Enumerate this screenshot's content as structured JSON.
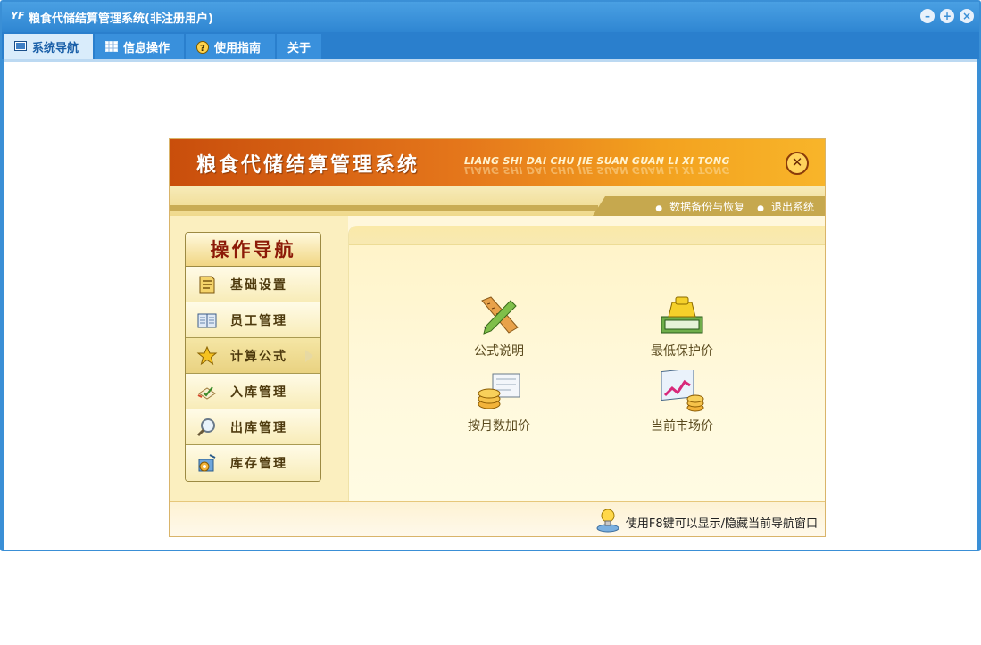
{
  "window": {
    "title": "粮食代储结算管理系统(非注册用户)",
    "app_icon": "yf-logo",
    "controls": [
      "minimize-icon",
      "maximize-icon",
      "close-icon"
    ]
  },
  "menu": {
    "tabs": [
      {
        "label": "系统导航",
        "icon": "monitor-icon",
        "active": true
      },
      {
        "label": "信息操作",
        "icon": "grid-icon",
        "active": false
      },
      {
        "label": "使用指南",
        "icon": "help-icon",
        "active": false
      },
      {
        "label": "关于",
        "icon": "",
        "active": false
      }
    ]
  },
  "panel": {
    "title": "粮食代储结算管理系统",
    "subtitle": "LIANG SHI DAI CHU JIE SUAN GUAN LI XI TONG",
    "links": [
      "数据备份与恢复",
      "退出系统"
    ],
    "nav_title": "操作导航",
    "nav_items": [
      {
        "label": "基础设置",
        "icon": "document-icon"
      },
      {
        "label": "员工管理",
        "icon": "book-icon"
      },
      {
        "label": "计算公式",
        "icon": "star-icon",
        "active": true
      },
      {
        "label": "入库管理",
        "icon": "checklist-icon"
      },
      {
        "label": "出库管理",
        "icon": "magnifier-icon"
      },
      {
        "label": "库存管理",
        "icon": "gear-box-icon"
      }
    ],
    "tiles": [
      {
        "label": "公式说明",
        "icon": "ruler-pencil-icon"
      },
      {
        "label": "最低保护价",
        "icon": "money-stack-icon"
      },
      {
        "label": "按月数加价",
        "icon": "coins-icon"
      },
      {
        "label": "当前市场价",
        "icon": "market-chart-icon"
      }
    ],
    "footer_hint": "使用F8键可以显示/隐藏当前导航窗口"
  },
  "colors": {
    "window_blue": "#3a8fd6",
    "banner_orange": "#e5771b",
    "nav_title_red": "#8c1a08",
    "panel_cream": "#fff7dc"
  }
}
